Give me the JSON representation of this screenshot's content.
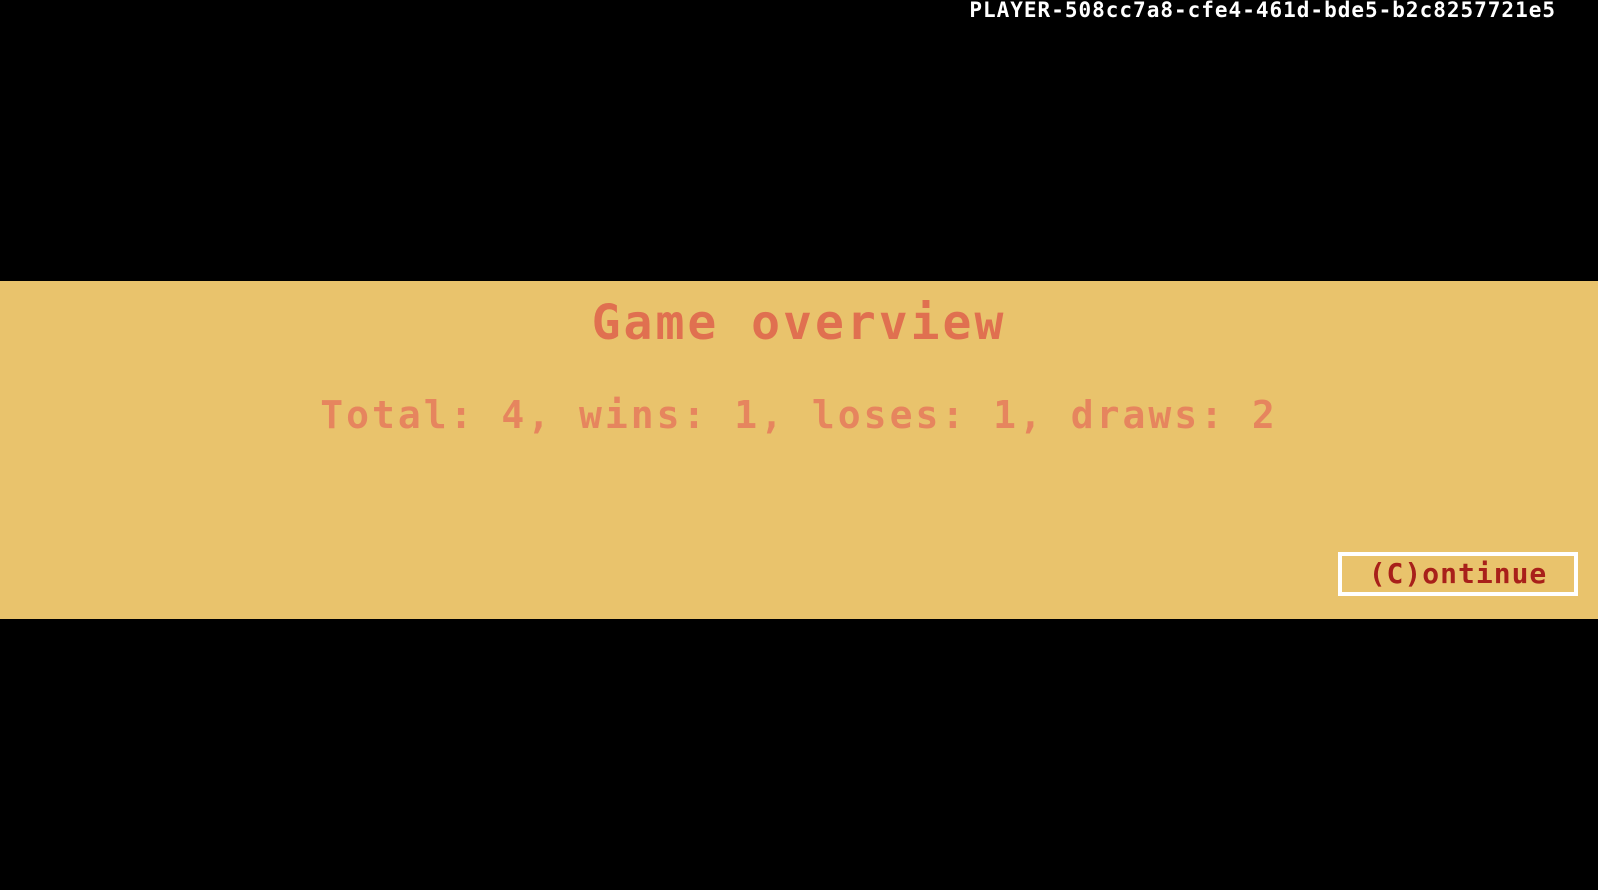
{
  "header": {
    "player_id": "PLAYER-508cc7a8-cfe4-461d-bde5-b2c8257721e5"
  },
  "overview": {
    "title": "Game overview",
    "summary": "Total: 4, wins: 1, loses: 1, draws: 2",
    "stats": {
      "total": 4,
      "wins": 1,
      "loses": 1,
      "draws": 2
    }
  },
  "actions": {
    "continue_label": "(C)ontinue"
  },
  "colors": {
    "background": "#000000",
    "panel": "#e9c36c",
    "title": "#e07050",
    "summary": "#e6855e",
    "button_text": "#a8201a",
    "button_border": "#ffffff",
    "player_id": "#ffffff"
  }
}
